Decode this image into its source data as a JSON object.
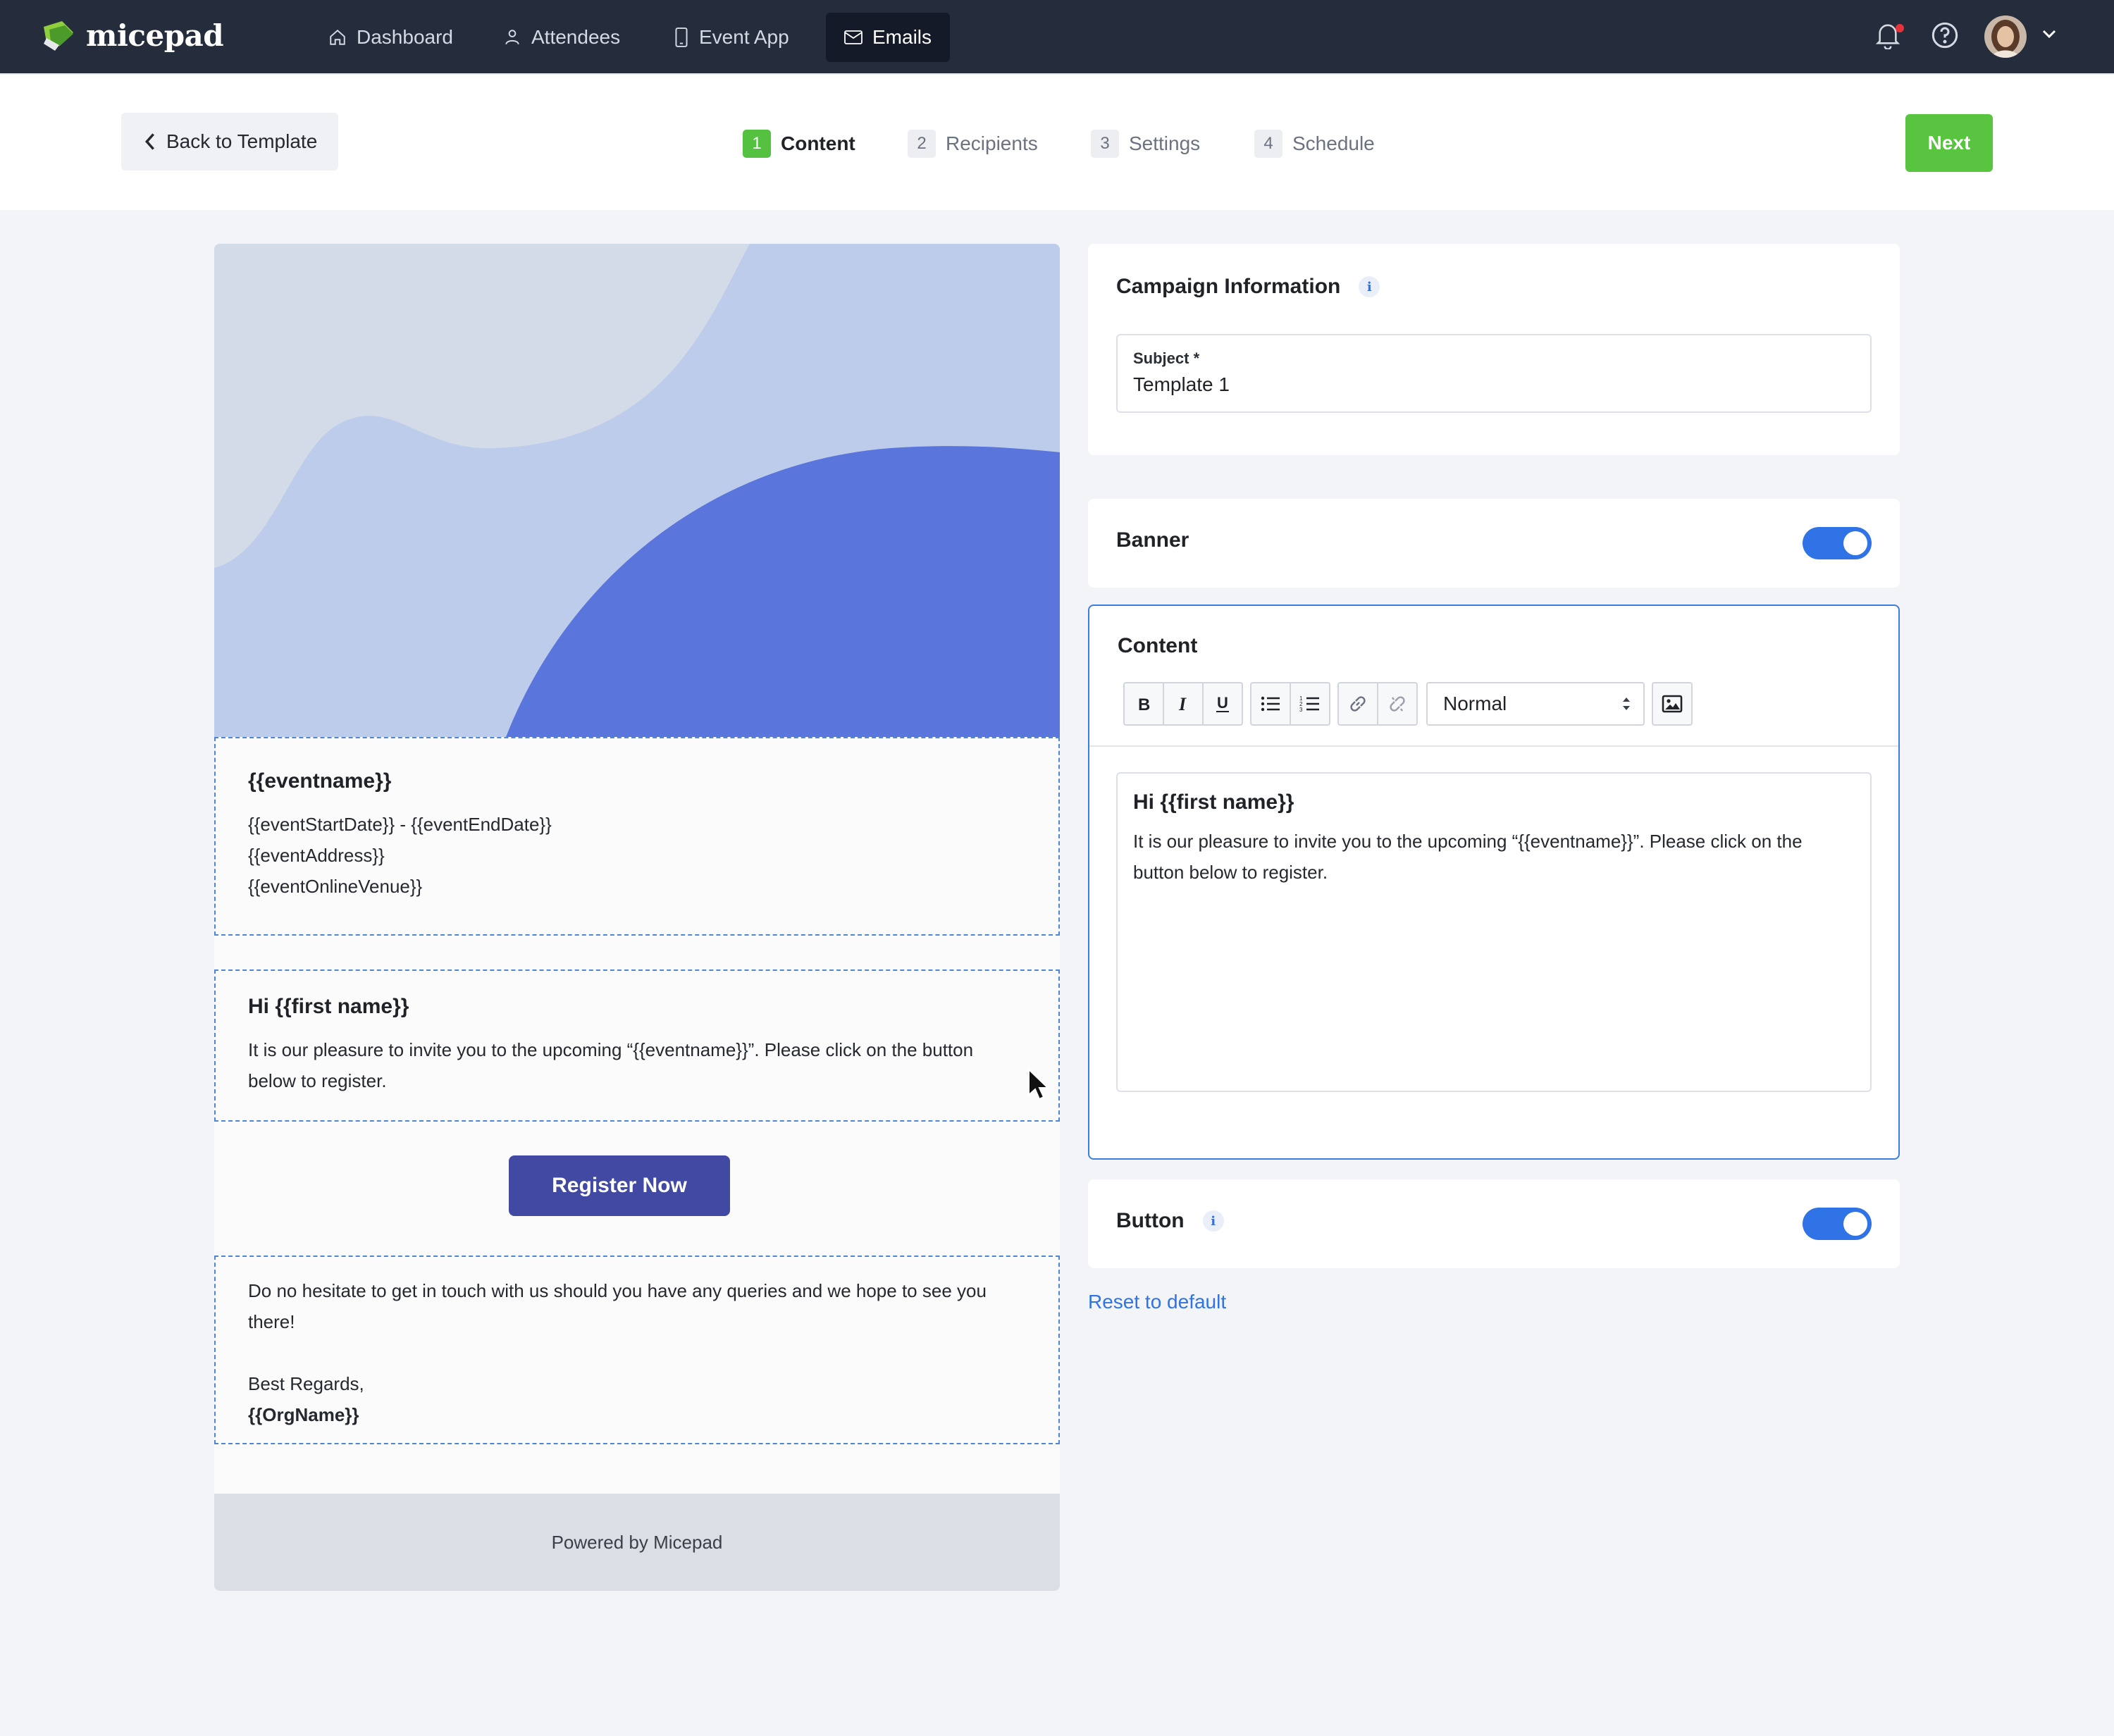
{
  "nav": {
    "logo_text": "micepad",
    "items": [
      {
        "label": "Dashboard",
        "icon": "home-icon"
      },
      {
        "label": "Attendees",
        "icon": "person-icon"
      },
      {
        "label": "Event App",
        "icon": "phone-icon"
      },
      {
        "label": "Emails",
        "icon": "mail-icon",
        "active": true
      }
    ],
    "right_icons": [
      "bell-icon",
      "help-icon",
      "chevron-down-icon"
    ]
  },
  "stepper": {
    "back_label": "Back to Template",
    "steps": [
      {
        "num": "1",
        "label": "Content",
        "active": true
      },
      {
        "num": "2",
        "label": "Recipients"
      },
      {
        "num": "3",
        "label": "Settings"
      },
      {
        "num": "4",
        "label": "Schedule"
      }
    ],
    "next_label": "Next"
  },
  "preview": {
    "event": {
      "title": "{{eventname}}",
      "lines": [
        "{{eventStartDate}} - {{eventEndDate}}",
        "{{eventAddress}}",
        "{{eventOnlineVenue}}"
      ]
    },
    "greeting": {
      "title": "Hi {{first name}}",
      "body": "It is our pleasure to invite you to the upcoming “{{eventname}}”. Please click on the button below to register."
    },
    "button_label": "Register Now",
    "closing": {
      "body": "Do no hesitate to get in touch with us should you have any queries and we hope to see you there!",
      "regards": "Best Regards,",
      "org": "{{OrgName}}"
    },
    "footer": "Powered by Micepad"
  },
  "campaign": {
    "title": "Campaign Information",
    "subject_label": "Subject *",
    "subject_value": "Template 1"
  },
  "banner": {
    "title": "Banner",
    "enabled": true
  },
  "content": {
    "title": "Content",
    "format_value": "Normal",
    "editor_title": "Hi {{first name}}",
    "editor_body": "It is our pleasure to invite you to the upcoming “{{eventname}}”. Please click on the button below to register."
  },
  "button_section": {
    "title": "Button",
    "enabled": true
  },
  "reset_label": "Reset to default",
  "colors": {
    "nav_bg": "#252c3c",
    "accent_green": "#58c43f",
    "primary_blue": "#2f73e6",
    "register_button": "#4149a3",
    "banner_light": "#bdcceb",
    "banner_dark": "#5a75dc"
  }
}
